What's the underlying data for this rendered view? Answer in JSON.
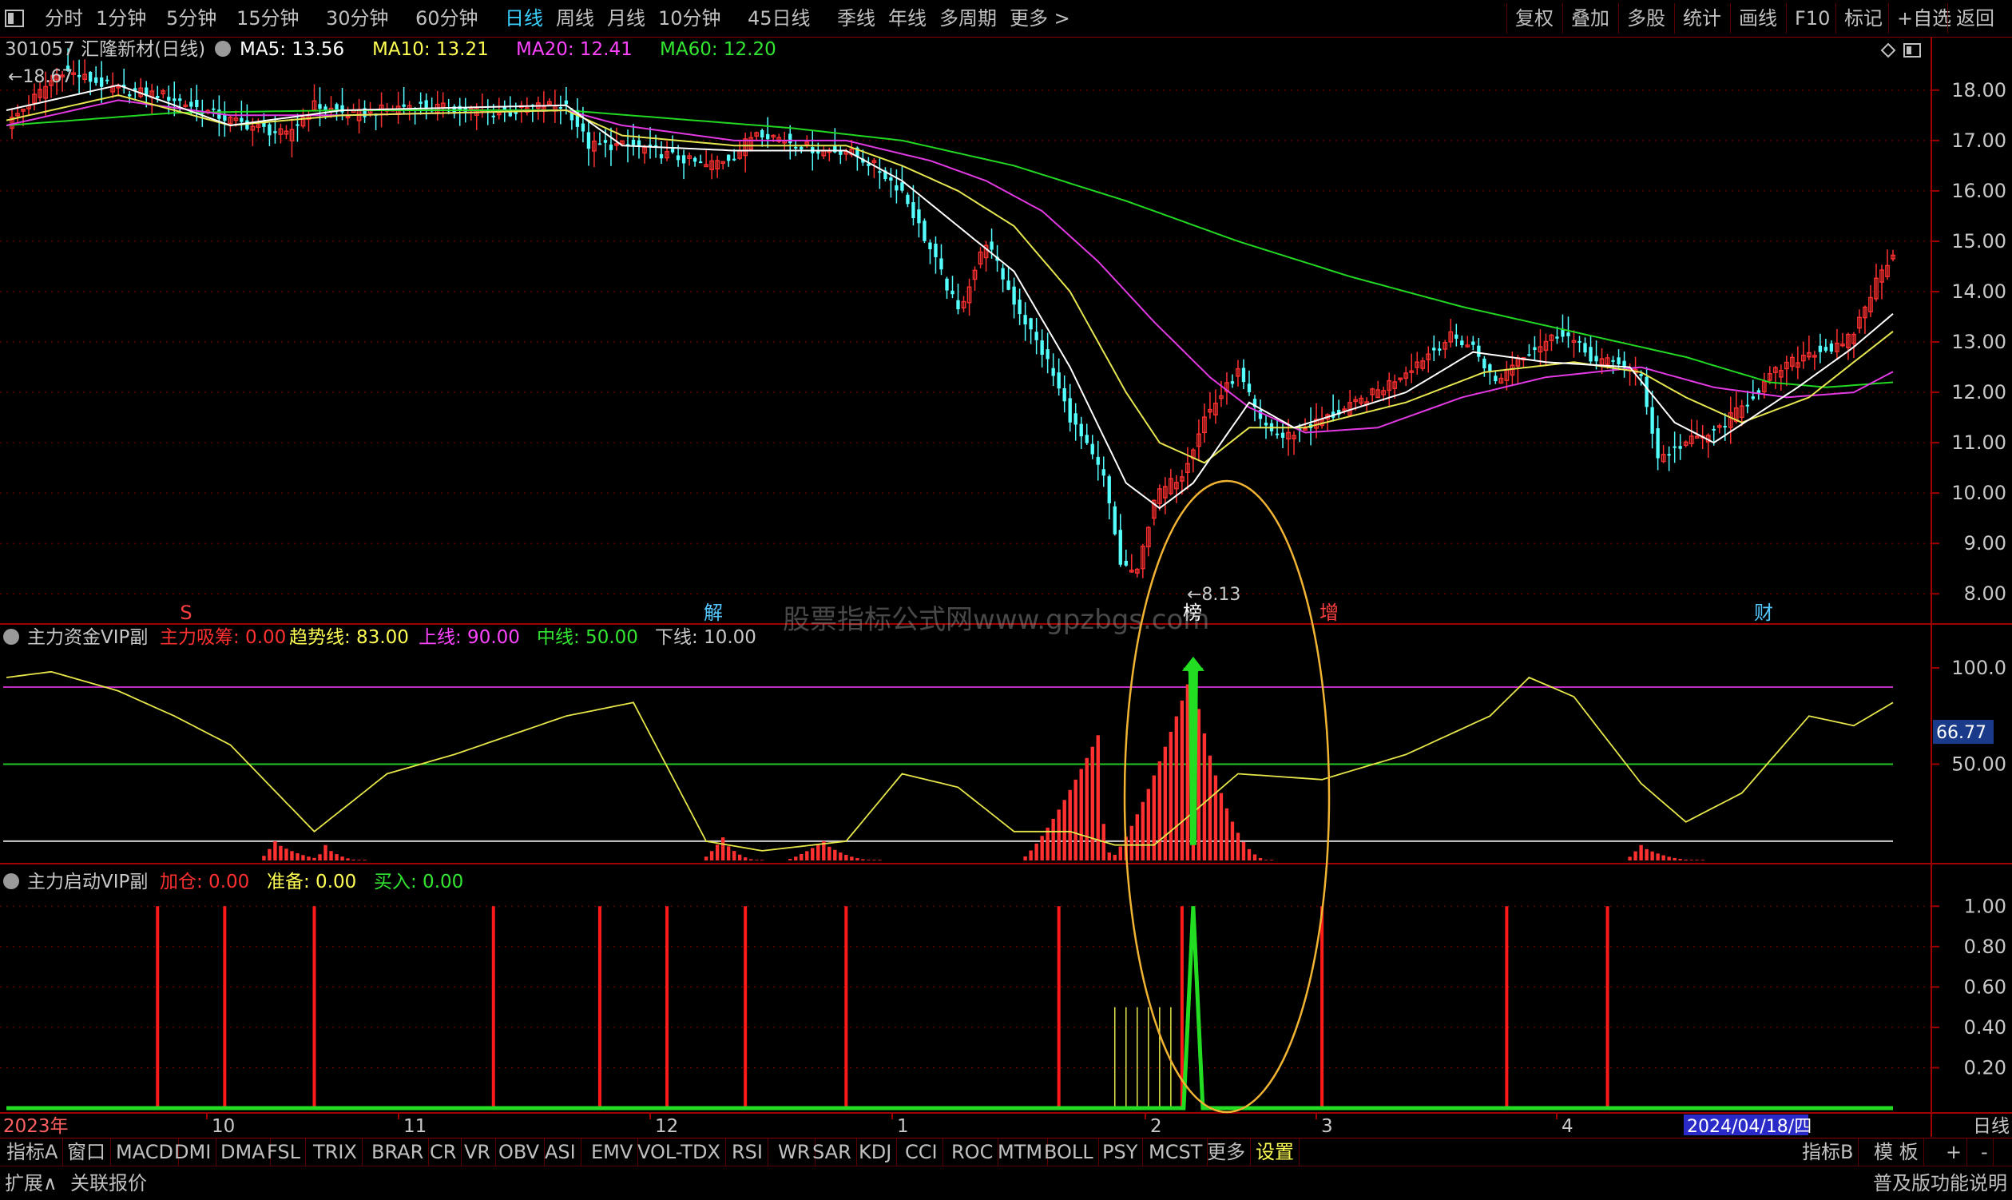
{
  "topbar": {
    "periods": [
      "分时",
      "1分钟",
      "5分钟",
      "15分钟",
      "30分钟",
      "60分钟",
      "日线",
      "周线",
      "月线",
      "10分钟",
      "45日线",
      "季线",
      "年线",
      "多周期",
      "更多 >"
    ],
    "active_period": "日线",
    "tools": [
      "复权",
      "叠加",
      "多股",
      "统计",
      "画线",
      "F10",
      "标记",
      "+自选",
      "返回"
    ]
  },
  "header": {
    "symbol": "301057 汇隆新材(日线)",
    "ma": [
      {
        "label": "MA5: 13.56",
        "color": "#ffffff"
      },
      {
        "label": "MA10: 13.21",
        "color": "#ffff54"
      },
      {
        "label": "MA20: 12.41",
        "color": "#ff44ff"
      },
      {
        "label": "MA60: 12.20",
        "color": "#32e632"
      }
    ]
  },
  "colors": {
    "up": "#ff3030",
    "down": "#54ffff",
    "ma5": "#ffffff",
    "ma10": "#e6e650",
    "ma20": "#e23ae2",
    "ma60": "#22d822",
    "axis": "#a00000",
    "grid": "#8b0000",
    "text": "#c8c8c8",
    "signal": "#ff1a1a",
    "green": "#22dd22",
    "ellipse": "#f0b432"
  },
  "chart_data": [
    {
      "type": "candlestick",
      "title": "301057 汇隆新材(日线)",
      "yticks": [
        18,
        17,
        16,
        15,
        14,
        13,
        12,
        11,
        10,
        9,
        8
      ],
      "ytick_labels": [
        "18.00",
        "17.00",
        "16.00",
        "15.00",
        "14.00",
        "13.00",
        "12.00",
        "11.00",
        "10.00",
        "9.00",
        "8.00"
      ],
      "ylim": [
        7.75,
        18.6
      ],
      "x_month_labels": [
        "10",
        "11",
        "12",
        "1",
        "2",
        "3",
        "4"
      ],
      "x_start_label": "2023年",
      "x_end_label": "2024/04/18/四",
      "annotations": {
        "high_mark": "18.67",
        "low_mark": "8.13",
        "events": [
          "S",
          "解",
          "榜",
          "增",
          "财"
        ]
      },
      "watermark": "股票指标公式网www.gpzbgs.com",
      "ohlc_keypoints": [
        [
          0,
          17.3
        ],
        [
          10,
          18.4
        ],
        [
          20,
          18.0
        ],
        [
          28,
          17.9
        ],
        [
          40,
          17.4
        ],
        [
          50,
          17.1
        ],
        [
          55,
          17.7
        ],
        [
          62,
          17.5
        ],
        [
          72,
          17.7
        ],
        [
          82,
          17.6
        ],
        [
          90,
          17.55
        ],
        [
          96,
          17.7
        ],
        [
          100,
          17.7
        ],
        [
          104,
          16.9
        ],
        [
          112,
          16.9
        ],
        [
          120,
          16.65
        ],
        [
          125,
          16.5
        ],
        [
          130,
          16.7
        ],
        [
          134,
          17.2
        ],
        [
          145,
          16.8
        ],
        [
          150,
          16.8
        ],
        [
          155,
          16.5
        ],
        [
          160,
          16.0
        ],
        [
          166,
          14.6
        ],
        [
          170,
          13.6
        ],
        [
          175,
          15.0
        ],
        [
          180,
          13.8
        ],
        [
          186,
          12.6
        ],
        [
          190,
          11.5
        ],
        [
          196,
          10.3
        ],
        [
          199,
          8.6
        ],
        [
          202,
          8.4
        ],
        [
          205,
          9.9
        ],
        [
          210,
          10.4
        ],
        [
          214,
          11.5
        ],
        [
          220,
          12.4
        ],
        [
          224,
          11.4
        ],
        [
          228,
          11.1
        ],
        [
          234,
          11.4
        ],
        [
          240,
          11.7
        ],
        [
          246,
          12.1
        ],
        [
          252,
          12.6
        ],
        [
          258,
          13.1
        ],
        [
          262,
          12.9
        ],
        [
          266,
          12.2
        ],
        [
          270,
          12.7
        ],
        [
          278,
          13.2
        ],
        [
          284,
          12.6
        ],
        [
          288,
          12.6
        ],
        [
          292,
          12.3
        ],
        [
          295,
          10.7
        ],
        [
          300,
          11.0
        ],
        [
          305,
          11.2
        ],
        [
          310,
          11.7
        ],
        [
          316,
          12.4
        ],
        [
          322,
          12.8
        ],
        [
          328,
          12.9
        ],
        [
          330,
          13.2
        ],
        [
          334,
          14.2
        ],
        [
          337,
          14.8
        ]
      ],
      "ma_keypoints": {
        "ma5": [
          [
            0,
            17.6
          ],
          [
            20,
            18.1
          ],
          [
            40,
            17.3
          ],
          [
            60,
            17.6
          ],
          [
            100,
            17.7
          ],
          [
            110,
            16.9
          ],
          [
            130,
            16.8
          ],
          [
            150,
            16.8
          ],
          [
            160,
            16.2
          ],
          [
            170,
            15.3
          ],
          [
            180,
            14.4
          ],
          [
            190,
            12.5
          ],
          [
            200,
            10.2
          ],
          [
            206,
            9.7
          ],
          [
            212,
            10.2
          ],
          [
            222,
            11.8
          ],
          [
            230,
            11.3
          ],
          [
            250,
            12.0
          ],
          [
            262,
            12.8
          ],
          [
            275,
            12.6
          ],
          [
            290,
            12.5
          ],
          [
            298,
            11.4
          ],
          [
            305,
            11.0
          ],
          [
            320,
            12.1
          ],
          [
            330,
            12.9
          ],
          [
            337,
            13.56
          ]
        ],
        "ma10": [
          [
            0,
            17.4
          ],
          [
            20,
            17.9
          ],
          [
            40,
            17.3
          ],
          [
            60,
            17.5
          ],
          [
            100,
            17.6
          ],
          [
            110,
            17.1
          ],
          [
            130,
            16.9
          ],
          [
            150,
            16.9
          ],
          [
            160,
            16.5
          ],
          [
            170,
            16.0
          ],
          [
            180,
            15.3
          ],
          [
            190,
            14.0
          ],
          [
            200,
            12.0
          ],
          [
            206,
            11.0
          ],
          [
            214,
            10.6
          ],
          [
            222,
            11.3
          ],
          [
            232,
            11.3
          ],
          [
            250,
            11.8
          ],
          [
            264,
            12.4
          ],
          [
            280,
            12.6
          ],
          [
            292,
            12.4
          ],
          [
            300,
            11.9
          ],
          [
            310,
            11.4
          ],
          [
            322,
            11.9
          ],
          [
            330,
            12.6
          ],
          [
            337,
            13.21
          ]
        ],
        "ma20": [
          [
            0,
            17.3
          ],
          [
            20,
            17.8
          ],
          [
            40,
            17.5
          ],
          [
            60,
            17.5
          ],
          [
            100,
            17.6
          ],
          [
            110,
            17.3
          ],
          [
            130,
            17.0
          ],
          [
            150,
            17.0
          ],
          [
            165,
            16.6
          ],
          [
            175,
            16.2
          ],
          [
            185,
            15.6
          ],
          [
            195,
            14.6
          ],
          [
            205,
            13.4
          ],
          [
            215,
            12.3
          ],
          [
            222,
            11.7
          ],
          [
            232,
            11.2
          ],
          [
            245,
            11.3
          ],
          [
            260,
            11.9
          ],
          [
            275,
            12.3
          ],
          [
            292,
            12.5
          ],
          [
            305,
            12.1
          ],
          [
            318,
            11.9
          ],
          [
            330,
            12.0
          ],
          [
            337,
            12.41
          ]
        ],
        "ma60": [
          [
            0,
            17.3
          ],
          [
            30,
            17.55
          ],
          [
            60,
            17.6
          ],
          [
            100,
            17.6
          ],
          [
            140,
            17.25
          ],
          [
            160,
            17.0
          ],
          [
            180,
            16.5
          ],
          [
            200,
            15.8
          ],
          [
            220,
            15.0
          ],
          [
            240,
            14.3
          ],
          [
            260,
            13.7
          ],
          [
            280,
            13.2
          ],
          [
            300,
            12.7
          ],
          [
            315,
            12.2
          ],
          [
            325,
            12.1
          ],
          [
            337,
            12.2
          ]
        ]
      }
    },
    {
      "type": "line+bar",
      "title": "主力资金VIP副",
      "legend": [
        {
          "label": "主力吸筹: 0.00",
          "color": "#ff3030"
        },
        {
          "label": "趋势线: 83.00",
          "color": "#ffff54"
        },
        {
          "label": "上线: 90.00",
          "color": "#ff44ff"
        },
        {
          "label": "中线: 50.00",
          "color": "#32e632"
        },
        {
          "label": "下线: 10.00",
          "color": "#c8c8c8"
        }
      ],
      "yticks": [
        100,
        50
      ],
      "ytick_labels": [
        "100.0",
        "50.00"
      ],
      "current_value_label": "66.77",
      "ylim": [
        0,
        112
      ],
      "levels": {
        "upper": 90,
        "middle": 50,
        "lower": 10
      },
      "trend_keypoints": [
        [
          0,
          95
        ],
        [
          8,
          98
        ],
        [
          20,
          88
        ],
        [
          30,
          75
        ],
        [
          40,
          60
        ],
        [
          55,
          15
        ],
        [
          68,
          45
        ],
        [
          80,
          55
        ],
        [
          100,
          75
        ],
        [
          112,
          82
        ],
        [
          125,
          10
        ],
        [
          135,
          5
        ],
        [
          150,
          10
        ],
        [
          160,
          45
        ],
        [
          170,
          38
        ],
        [
          180,
          15
        ],
        [
          190,
          15
        ],
        [
          198,
          8
        ],
        [
          205,
          8
        ],
        [
          212,
          25
        ],
        [
          220,
          45
        ],
        [
          235,
          42
        ],
        [
          250,
          55
        ],
        [
          265,
          75
        ],
        [
          272,
          95
        ],
        [
          280,
          85
        ],
        [
          292,
          40
        ],
        [
          300,
          20
        ],
        [
          310,
          35
        ],
        [
          322,
          75
        ],
        [
          330,
          70
        ],
        [
          337,
          82
        ]
      ],
      "bar_segments": [
        {
          "from": 46,
          "to": 60,
          "peak": 10,
          "peak_at": 48
        },
        {
          "from": 56,
          "to": 64,
          "peak": 8,
          "peak_at": 57
        },
        {
          "from": 125,
          "to": 135,
          "peak": 12,
          "peak_at": 128
        },
        {
          "from": 140,
          "to": 156,
          "peak": 10,
          "peak_at": 146
        },
        {
          "from": 182,
          "to": 198,
          "peak": 65,
          "peak_at": 195
        },
        {
          "from": 198,
          "to": 226,
          "peak": 100,
          "peak_at": 212
        },
        {
          "from": 290,
          "to": 303,
          "peak": 8,
          "peak_at": 292
        }
      ]
    },
    {
      "type": "signal",
      "title": "主力启动VIP副",
      "legend": [
        {
          "label": "加仓: 0.00",
          "color": "#ff3030"
        },
        {
          "label": "准备: 0.00",
          "color": "#ffff54"
        },
        {
          "label": "买入: 0.00",
          "color": "#32e632"
        }
      ],
      "yticks": [
        1.0,
        0.8,
        0.6,
        0.4,
        0.2
      ],
      "ytick_labels": [
        "1.00",
        "0.80",
        "0.60",
        "0.40",
        "0.20"
      ],
      "ylim": [
        0,
        1.1
      ],
      "red_signals": [
        27,
        39,
        55,
        87,
        106,
        118,
        132,
        150,
        188,
        210,
        235,
        268,
        286
      ],
      "yellow_prep": [
        198,
        200,
        202,
        204,
        206,
        208
      ],
      "buy_spike_at": 212
    }
  ],
  "bottombar": {
    "tabs": [
      "指标A",
      "窗口",
      "MACD",
      "DMI",
      "DMA",
      "FSL",
      "TRIX",
      "BRAR",
      "CR",
      "VR",
      "OBV",
      "ASI",
      "EMV",
      "VOL-TDX",
      "RSI",
      "WR",
      "SAR",
      "KDJ",
      "CCI",
      "ROC",
      "MTM",
      "BOLL",
      "PSY",
      "MCST",
      "更多",
      "设置"
    ],
    "highlight": "设置",
    "right_tabs": [
      "指标B",
      "模 板",
      "+",
      "-"
    ]
  },
  "statusbar": {
    "left": [
      "扩展∧",
      "关联报价"
    ],
    "right": "普及版功能说明",
    "period_label": "日线"
  }
}
